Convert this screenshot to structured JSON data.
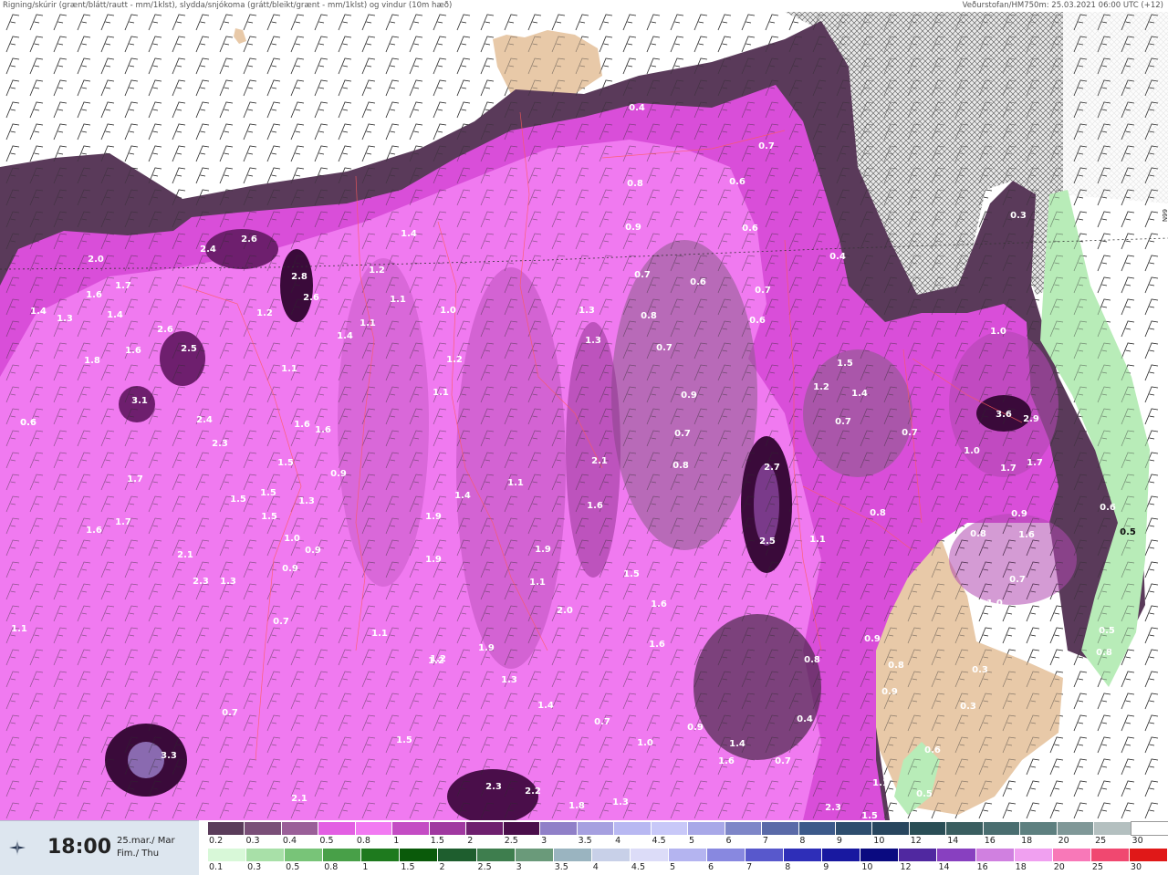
{
  "header": {
    "title_left": "Rigning/skúrir (grænt/blátt/rautt - mm/1klst), slydda/snjókoma (grátt/bleikt/grænt - mm/1klst) og vindur (10m hæð)",
    "title_right": "Veðurstofan/HM750m: 25.03.2021 06:00 UTC (+12)"
  },
  "map": {
    "grid_label": "66N",
    "precip_labels": [
      "0.4",
      "0.7",
      "0.8",
      "0.6",
      "0.9",
      "0.6",
      "0.3",
      "0.4",
      "0.7",
      "0.6",
      "0.7",
      "0.8",
      "0.6",
      "0.7",
      "1.4",
      "1.2",
      "1.1",
      "1.0",
      "1.3",
      "1.3",
      "0.7",
      "0.9",
      "0.7",
      "0.8",
      "1.0",
      "1.5",
      "1.2",
      "1.4",
      "0.7",
      "0.6",
      "3.6",
      "2.9",
      "2.0",
      "1.7",
      "1.6",
      "1.4",
      "1.3",
      "1.4",
      "2.4",
      "2.6",
      "2.8",
      "2.6",
      "1.2",
      "1.1",
      "1.4",
      "1.2",
      "1.1",
      "1.1",
      "1.6",
      "1.8",
      "2.6",
      "2.5",
      "3.1",
      "2.4",
      "2.3",
      "0.6",
      "1.6",
      "1.6",
      "1.5",
      "0.9",
      "1.0",
      "2.1",
      "1.7",
      "2.7",
      "1.7",
      "1.7",
      "1.5",
      "1.5",
      "1.3",
      "1.9",
      "1.4",
      "1.1",
      "1.6",
      "0.8",
      "0.9",
      "1.6",
      "1.7",
      "1.5",
      "1.0",
      "0.9",
      "1.9",
      "2.5",
      "1.1",
      "0.5",
      "0.6",
      "2.1",
      "2.3",
      "1.3",
      "0.9",
      "1.1",
      "1.5",
      "1.6",
      "1.0",
      "0.8",
      "0.7",
      "1.1",
      "1.1",
      "1.9",
      "2.0",
      "1.6",
      "1.6",
      "0.9",
      "0.8",
      "0.3",
      "0.8",
      "1.2",
      "1.9",
      "1.3",
      "1.4",
      "0.7",
      "1.0",
      "0.9",
      "0.8",
      "0.9",
      "0.3",
      "0.6",
      "0.7",
      "3.3",
      "1.5",
      "1.4",
      "0.4",
      "1.6",
      "0.7",
      "1.1",
      "0.5",
      "0.5",
      "2.1",
      "2.3",
      "2.2",
      "1.8",
      "1.3",
      "2.3",
      "1.5",
      "1.2",
      "0.7"
    ]
  },
  "footer": {
    "time": "18:00",
    "date_line1": "25.mar./ Mar",
    "date_line2": "Fim./ Thu"
  },
  "legend": {
    "snow_labels": [
      "0.2",
      "0.3",
      "0.4",
      "0.5",
      "0.8",
      "1",
      "1.5",
      "2",
      "2.5",
      "3",
      "3.5",
      "4",
      "4.5",
      "5",
      "6",
      "7",
      "8",
      "9",
      "10",
      "12",
      "14",
      "16",
      "18",
      "20",
      "25",
      "30"
    ],
    "snow_colors": [
      "#5a3c5a",
      "#7a4f78",
      "#9a5f98",
      "#e35fe3",
      "#f27af2",
      "#c44cc4",
      "#a038a0",
      "#6e1f6e",
      "#4a0e4a",
      "#9080c8",
      "#a6a0e0",
      "#b8b8f2",
      "#c8c8f8",
      "#a8a8e8",
      "#7e86c8",
      "#5a6aa8",
      "#3c5a8a",
      "#2e4e6e",
      "#28465e",
      "#2a4e56",
      "#3a5e60",
      "#4a6e70",
      "#5e8080",
      "#809898",
      "#b4c0c0",
      "#ffffff"
    ],
    "rain_labels": [
      "0.1",
      "0.3",
      "0.5",
      "0.8",
      "1",
      "1.5",
      "2",
      "2.5",
      "3",
      "3.5",
      "4",
      "4.5",
      "5",
      "6",
      "7",
      "8",
      "9",
      "10",
      "12",
      "14",
      "16",
      "18",
      "20",
      "25",
      "30"
    ],
    "rain_colors": [
      "#d8f8d8",
      "#a8e0a8",
      "#78c478",
      "#48a048",
      "#1e7a1e",
      "#0a5a0a",
      "#1e5e2e",
      "#3e7e4e",
      "#6a9a7a",
      "#9ab4c0",
      "#c8d0e8",
      "#dcdcf8",
      "#b4b4f0",
      "#8888e0",
      "#5858cc",
      "#2e2eb8",
      "#1818a0",
      "#0a0a80",
      "#5028a0",
      "#8840c0",
      "#d080e0",
      "#f0a0f0",
      "#f878b8",
      "#f04870",
      "#e01818"
    ]
  }
}
